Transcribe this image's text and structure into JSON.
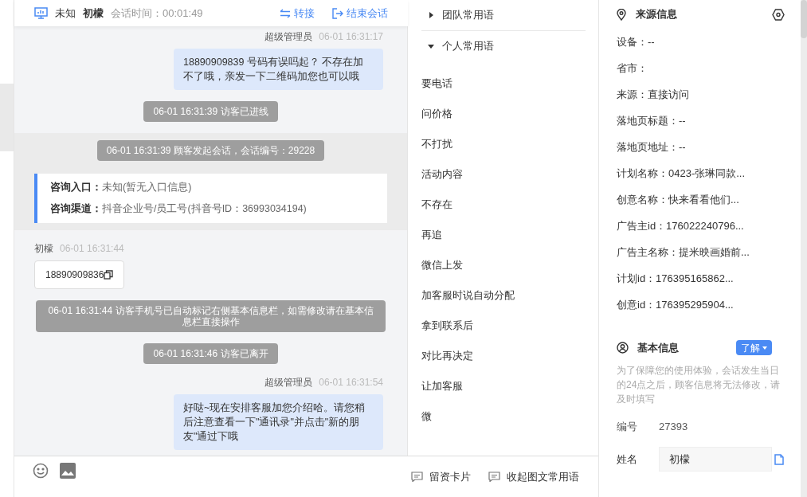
{
  "header": {
    "status": "未知",
    "name": "初檬",
    "duration": "会话时间：00:01:49",
    "actions": [
      {
        "kind": "transfer",
        "label": "转接"
      },
      {
        "kind": "end",
        "label": "结束会话"
      }
    ]
  },
  "messages": [
    {
      "kind": "outgoing",
      "sender": "超级管理员",
      "time": "06-01 16:31:17",
      "text": "18890909839 号码有误吗起？ 不存在加不了哦，亲发一下二维码加您也可以哦"
    },
    {
      "kind": "system",
      "text": "06-01 16:31:39 访客已进线"
    },
    {
      "kind": "session",
      "text": "06-01 16:31:39 顾客发起会话，会话编号：29228",
      "rows": [
        {
          "label": "咨询入口：",
          "value": "未知(暂无入口信息)"
        },
        {
          "label": "咨询渠道：",
          "value": "抖音企业号/员工号(抖音号ID：36993034194)"
        }
      ]
    },
    {
      "kind": "phone",
      "sender": "初檬",
      "time": "06-01 16:31:44",
      "text": "18890909836"
    },
    {
      "kind": "system",
      "text": "06-01 16:31:44 访客手机号已自动标记右侧基本信息栏，如需修改请在基本信息栏直接操作"
    },
    {
      "kind": "system",
      "text": "06-01 16:31:46 访客已离开"
    },
    {
      "kind": "outgoing",
      "sender": "超级管理员",
      "time": "06-01 16:31:54",
      "text": "好哒~现在安排客服加您介绍哈。请您稍后注意查看一下\"通讯录\"并点击\"新的朋友\"通过下哦"
    }
  ],
  "phrase_groups": [
    {
      "title": "团队常用语",
      "expanded": false
    },
    {
      "title": "个人常用语",
      "expanded": true,
      "items": [
        "要电话",
        "问价格",
        "不打扰",
        "活动内容",
        "不存在",
        "再追",
        "微信上发",
        "加客服时说自动分配",
        "拿到联系后",
        "对比再决定",
        "让加客服",
        "微"
      ]
    }
  ],
  "phrase_tools": [
    "留资卡片",
    "收起图文常用语"
  ],
  "source": {
    "title": "来源信息",
    "fields": [
      "设备：--",
      "省市：",
      "来源：直接访问",
      "落地页标题：--",
      "落地页地址：--",
      "计划名称：0423-张琳同款...",
      "创意名称：快来看看他们...",
      "广告主id：176022240796...",
      "广告主名称：提米映画婚前...",
      "计划id：176395165862...",
      "创意id：176395295904..."
    ]
  },
  "basic": {
    "title": "基本信息",
    "button": "了解",
    "note": "为了保障您的使用体验，会话发生当日的24点之后，顾客信息将无法修改，请及时填写",
    "id_label": "编号",
    "id_value": "27393",
    "name_label": "姓名",
    "name_value": "初檬"
  }
}
